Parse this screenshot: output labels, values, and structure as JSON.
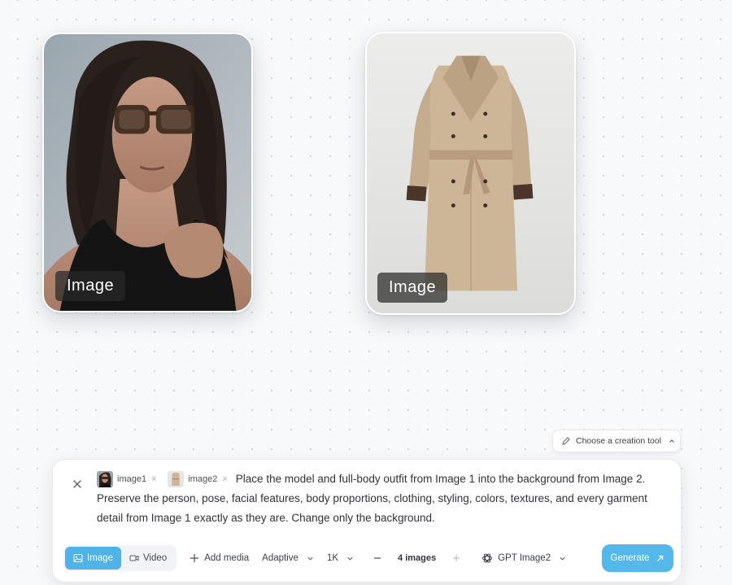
{
  "canvas": {
    "cards": [
      {
        "label": "Image",
        "subject": "woman-portrait-sunglasses-photo"
      },
      {
        "label": "Image",
        "subject": "beige-trench-coat-photo"
      }
    ]
  },
  "tool_chip": {
    "label": "Choose a creation tool",
    "icon": "pencil-icon"
  },
  "composer": {
    "references": [
      {
        "label": "image1",
        "thumb": "portrait-thumbnail"
      },
      {
        "label": "image2",
        "thumb": "coat-thumbnail"
      }
    ],
    "prompt_text": "Place the model and full-body outfit from Image 1 into the background from Image 2. Preserve the person, pose, facial features, body proportions, clothing, styling, colors, textures, and every garment detail from Image 1 exactly as they are. Change only the background."
  },
  "toolbar": {
    "mode_image": "Image",
    "mode_video": "Video",
    "add_media": "Add media",
    "aspect": "Adaptive",
    "resolution": "1K",
    "count": "4 images",
    "model": "GPT Image2",
    "generate": "Generate"
  },
  "colors": {
    "accent": "#4fb3e8",
    "generate": "#55b8ea",
    "card_label_bg": "#282828"
  }
}
